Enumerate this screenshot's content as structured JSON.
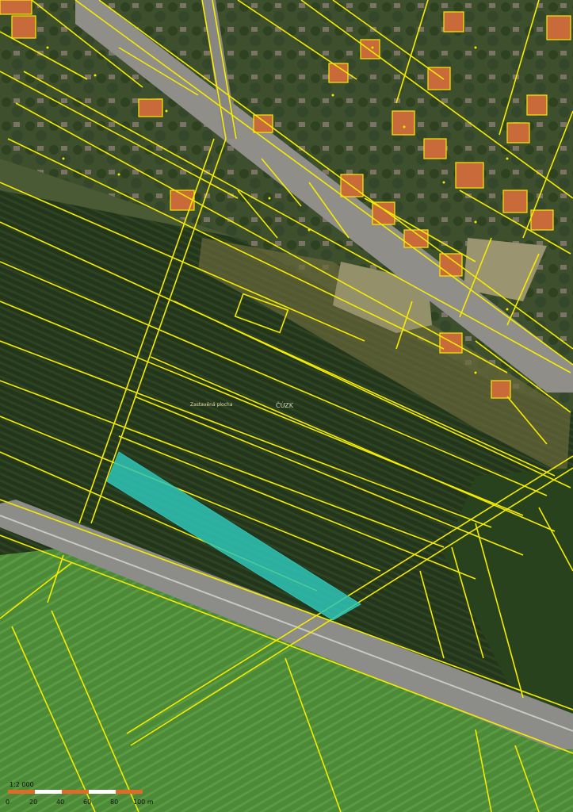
{
  "map": {
    "watermark": "ČÚZK",
    "area_label": "Zastavěná plocha",
    "highlight_color": "#2ec4b6",
    "parcel_line_color": "#f5ec00",
    "scale": {
      "ratio": "1:2 000",
      "ticks": [
        "0",
        "20",
        "40",
        "60",
        "80",
        "100 m"
      ]
    }
  }
}
